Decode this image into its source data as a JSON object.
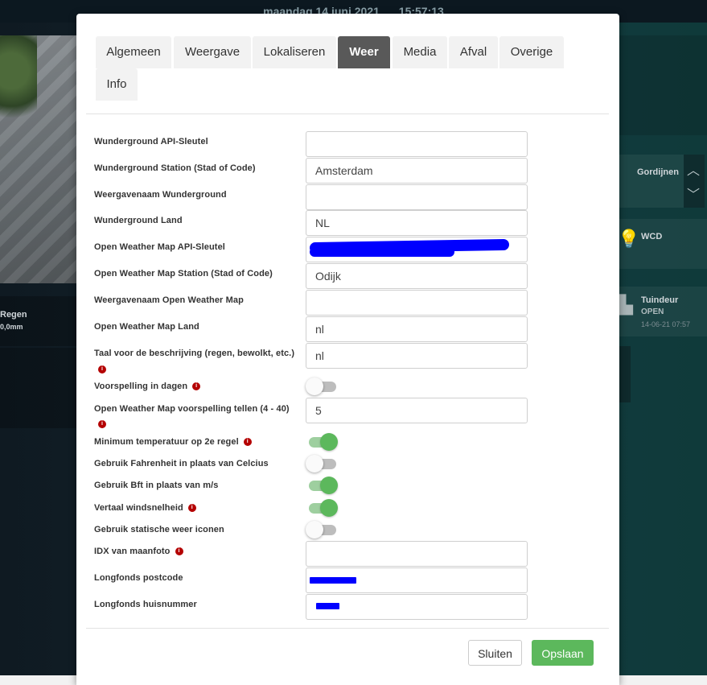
{
  "background": {
    "date": "maandag 14 juni 2021",
    "time": "15:57:13",
    "tiles": {
      "regen_label": "Regen",
      "regen_value": "0,0mm",
      "gordijnen_label": "Gordijnen",
      "wcd_label": "WCD",
      "tuindeur_label": "Tuindeur",
      "tuindeur_status": "OPEN",
      "tuindeur_time": "14-06-21 07:57"
    }
  },
  "tabs": [
    "Algemeen",
    "Weergave",
    "Lokaliseren",
    "Weer",
    "Media",
    "Afval",
    "Overige",
    "Info"
  ],
  "active_tab": "Weer",
  "fields": {
    "wu_api_key": {
      "label": "Wunderground API-Sleutel",
      "value": ""
    },
    "wu_station": {
      "label": "Wunderground Station (Stad of Code)",
      "value": "Amsterdam"
    },
    "wu_display_name": {
      "label": "Weergavenaam Wunderground",
      "value": ""
    },
    "wu_country": {
      "label": "Wunderground Land",
      "value": "NL"
    },
    "owm_api_key": {
      "label": "Open Weather Map API-Sleutel",
      "value": ""
    },
    "owm_station": {
      "label": "Open Weather Map Station (Stad of Code)",
      "value": "Odijk"
    },
    "owm_display_name": {
      "label": "Weergavenaam Open Weather Map",
      "value": ""
    },
    "owm_country": {
      "label": "Open Weather Map Land",
      "value": "nl"
    },
    "description_language": {
      "label": "Taal voor de beschrijving (regen, bewolkt, etc.)",
      "value": "nl"
    },
    "forecast_days": {
      "label": "Voorspelling in dagen",
      "on": false
    },
    "owm_forecast_count": {
      "label": "Open Weather Map voorspelling tellen (4 - 40)",
      "value": "5"
    },
    "min_temp_second_line": {
      "label": "Minimum temperatuur op 2e regel",
      "on": true
    },
    "use_fahrenheit": {
      "label": "Gebruik Fahrenheit in plaats van Celcius",
      "on": false
    },
    "use_bft": {
      "label": "Gebruik Bft in plaats van m/s",
      "on": true
    },
    "translate_windspeed": {
      "label": "Vertaal windsnelheid",
      "on": true
    },
    "static_weather_icons": {
      "label": "Gebruik statische weer iconen",
      "on": false
    },
    "moon_photo_idx": {
      "label": "IDX van maanfoto",
      "value": ""
    },
    "longfonds_postcode": {
      "label": "Longfonds postcode",
      "value": ""
    },
    "longfonds_house_number": {
      "label": "Longfonds huisnummer",
      "value": ""
    }
  },
  "buttons": {
    "close": "Sluiten",
    "save": "Opslaan"
  },
  "colors": {
    "active_tab": "#595959",
    "toggle_on": "#5cb85c",
    "save_button": "#5cb85c",
    "info_icon": "#b40000",
    "redaction": "#0000ff"
  }
}
